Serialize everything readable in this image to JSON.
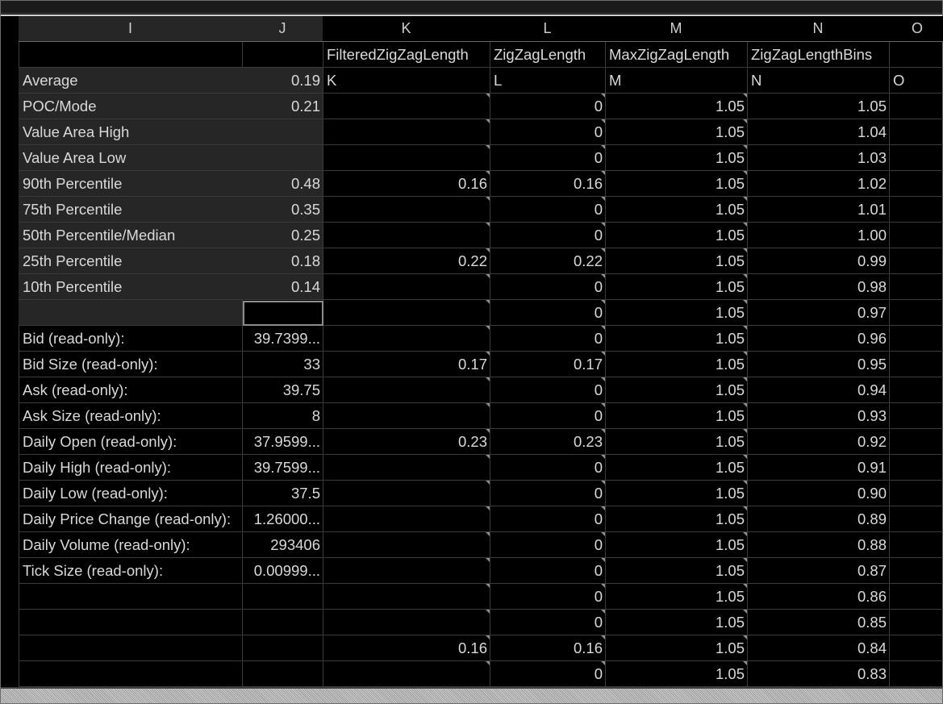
{
  "columns": [
    {
      "id": "I",
      "header": "I",
      "sub": ""
    },
    {
      "id": "J",
      "header": "J",
      "sub": ""
    },
    {
      "id": "K",
      "header": "K",
      "sub": "FilteredZigZagLength"
    },
    {
      "id": "L",
      "header": "L",
      "sub": "ZigZagLength"
    },
    {
      "id": "M",
      "header": "M",
      "sub": "MaxZigZagLength"
    },
    {
      "id": "N",
      "header": "N",
      "sub": "ZigZagLengthBins"
    },
    {
      "id": "O",
      "header": "O",
      "sub": ""
    }
  ],
  "letter_row": [
    "",
    "",
    "K",
    "L",
    "M",
    "N",
    "O"
  ],
  "stats": [
    {
      "label": "Average",
      "value": "0.19"
    },
    {
      "label": "POC/Mode",
      "value": "0.21"
    },
    {
      "label": "Value Area High",
      "value": ""
    },
    {
      "label": "Value Area Low",
      "value": ""
    },
    {
      "label": "90th Percentile",
      "value": "0.48"
    },
    {
      "label": "75th Percentile",
      "value": "0.35"
    },
    {
      "label": "50th Percentile/Median",
      "value": "0.25"
    },
    {
      "label": "25th Percentile",
      "value": "0.18"
    },
    {
      "label": "10th Percentile",
      "value": "0.14"
    },
    {
      "label": "",
      "value": ""
    },
    {
      "label": "Bid (read-only):",
      "value": "39.7399..."
    },
    {
      "label": "Bid Size (read-only):",
      "value": "33"
    },
    {
      "label": "Ask (read-only):",
      "value": "39.75"
    },
    {
      "label": "Ask Size (read-only):",
      "value": "8"
    },
    {
      "label": "Daily Open (read-only):",
      "value": "37.9599..."
    },
    {
      "label": "Daily High (read-only):",
      "value": "39.7599..."
    },
    {
      "label": "Daily Low (read-only):",
      "value": "37.5"
    },
    {
      "label": "Daily Price Change (read-only):",
      "value": "1.26000..."
    },
    {
      "label": "Daily Volume (read-only):",
      "value": "293406"
    },
    {
      "label": "Tick Size (read-only):",
      "value": "0.00999..."
    },
    {
      "label": "",
      "value": ""
    },
    {
      "label": "",
      "value": ""
    },
    {
      "label": "",
      "value": ""
    },
    {
      "label": "",
      "value": ""
    }
  ],
  "data_rows": [
    {
      "k": "",
      "l": "0",
      "m": "1.05",
      "n": "1.05"
    },
    {
      "k": "",
      "l": "0",
      "m": "1.05",
      "n": "1.04"
    },
    {
      "k": "",
      "l": "0",
      "m": "1.05",
      "n": "1.03"
    },
    {
      "k": "0.16",
      "l": "0.16",
      "m": "1.05",
      "n": "1.02"
    },
    {
      "k": "",
      "l": "0",
      "m": "1.05",
      "n": "1.01"
    },
    {
      "k": "",
      "l": "0",
      "m": "1.05",
      "n": "1.00"
    },
    {
      "k": "0.22",
      "l": "0.22",
      "m": "1.05",
      "n": "0.99"
    },
    {
      "k": "",
      "l": "0",
      "m": "1.05",
      "n": "0.98"
    },
    {
      "k": "",
      "l": "0",
      "m": "1.05",
      "n": "0.97"
    },
    {
      "k": "",
      "l": "0",
      "m": "1.05",
      "n": "0.96"
    },
    {
      "k": "0.17",
      "l": "0.17",
      "m": "1.05",
      "n": "0.95"
    },
    {
      "k": "",
      "l": "0",
      "m": "1.05",
      "n": "0.94"
    },
    {
      "k": "",
      "l": "0",
      "m": "1.05",
      "n": "0.93"
    },
    {
      "k": "0.23",
      "l": "0.23",
      "m": "1.05",
      "n": "0.92"
    },
    {
      "k": "",
      "l": "0",
      "m": "1.05",
      "n": "0.91"
    },
    {
      "k": "",
      "l": "0",
      "m": "1.05",
      "n": "0.90"
    },
    {
      "k": "",
      "l": "0",
      "m": "1.05",
      "n": "0.89"
    },
    {
      "k": "",
      "l": "0",
      "m": "1.05",
      "n": "0.88"
    },
    {
      "k": "",
      "l": "0",
      "m": "1.05",
      "n": "0.87"
    },
    {
      "k": "",
      "l": "0",
      "m": "1.05",
      "n": "0.86"
    },
    {
      "k": "",
      "l": "0",
      "m": "1.05",
      "n": "0.85"
    },
    {
      "k": "0.16",
      "l": "0.16",
      "m": "1.05",
      "n": "0.84"
    },
    {
      "k": "",
      "l": "0",
      "m": "1.05",
      "n": "0.83"
    }
  ]
}
